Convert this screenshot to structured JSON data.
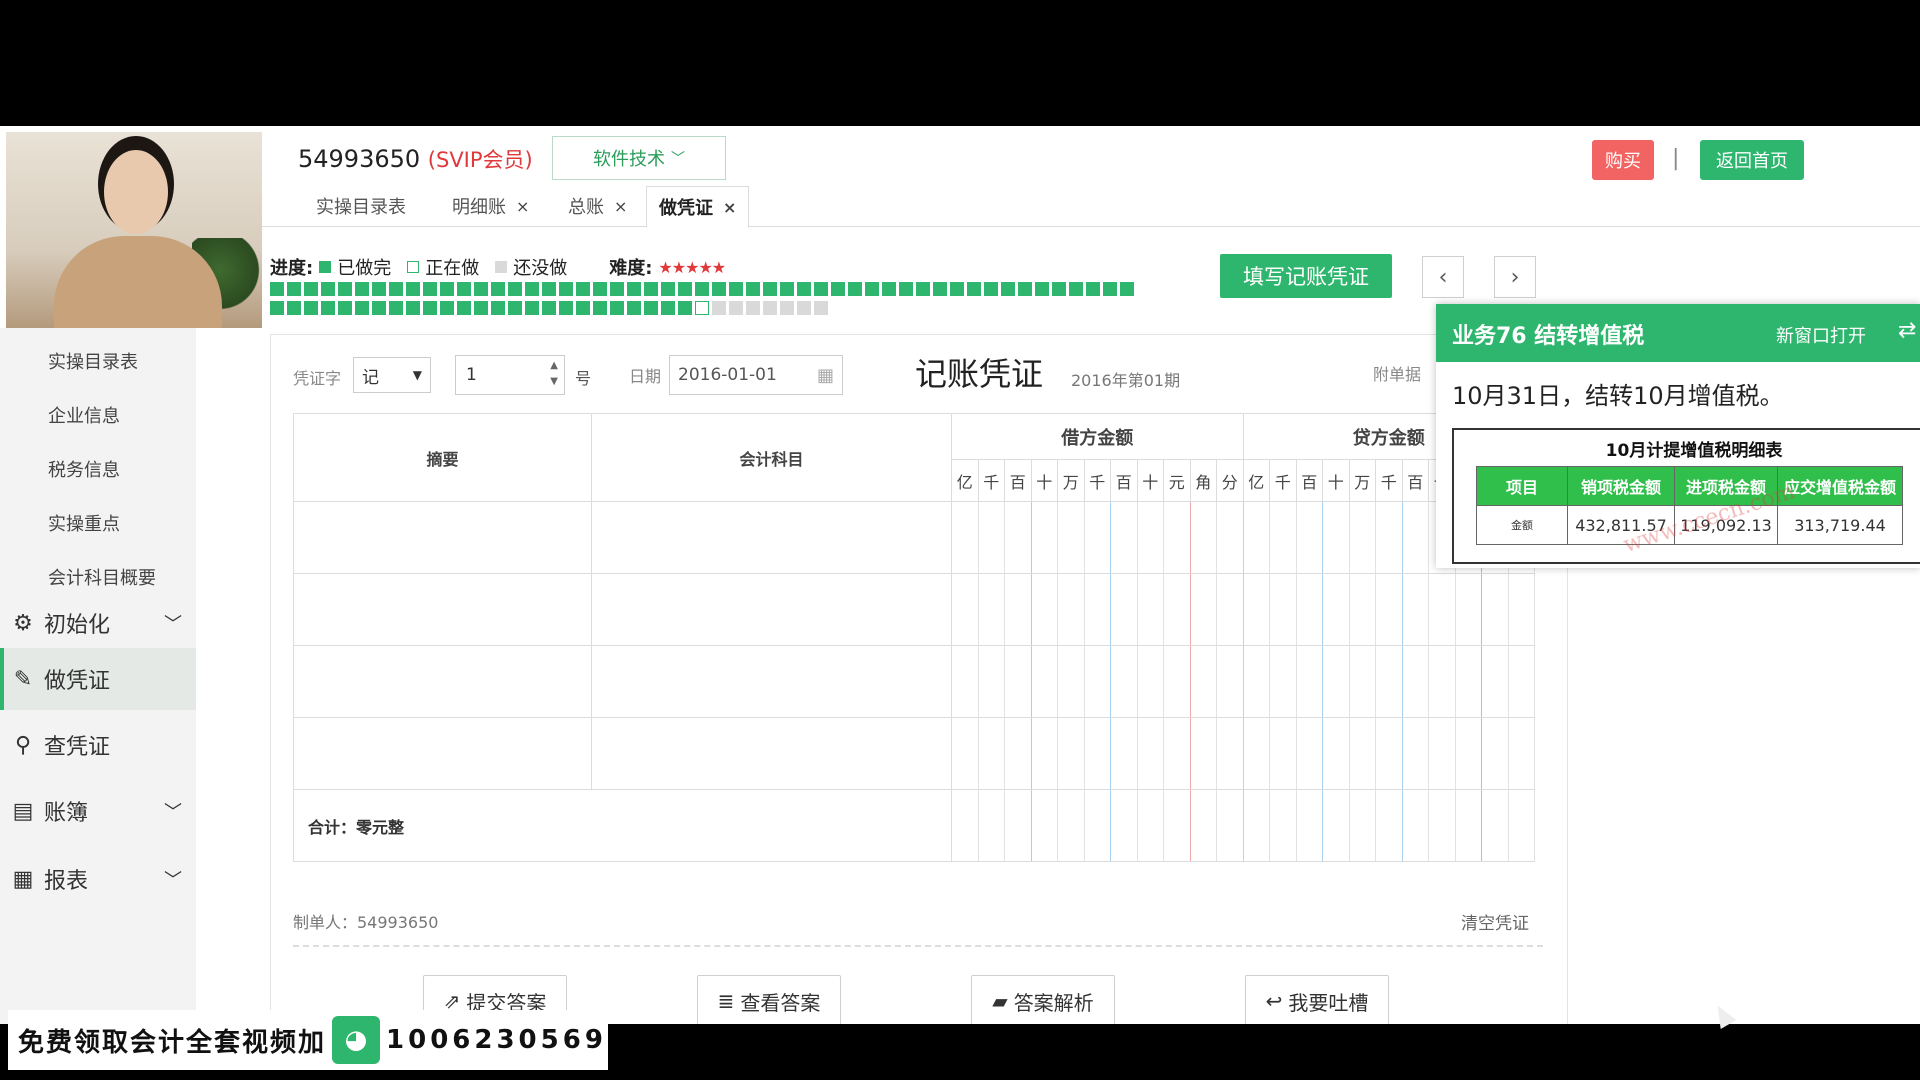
{
  "header": {
    "user_id": "54993650",
    "vip_label": "(SVIP会员)",
    "dropdown_label": "软件技术",
    "buy_label": "购买",
    "separator": "|",
    "home_label": "返回首页"
  },
  "tabs": [
    {
      "label": "实操目录表",
      "closable": false
    },
    {
      "label": "明细账",
      "closable": true
    },
    {
      "label": "总账",
      "closable": true
    },
    {
      "label": "做凭证",
      "closable": true
    }
  ],
  "tab_close_glyph": "×",
  "sidebar": {
    "sub_items": [
      "实操目录表",
      "企业信息",
      "税务信息",
      "实操重点",
      "会计科目概要"
    ],
    "main_items": [
      {
        "label": "初始化",
        "icon": "gear-icon",
        "expandable": true
      },
      {
        "label": "做凭证",
        "icon": "pen-icon",
        "expandable": false
      },
      {
        "label": "查凭证",
        "icon": "search-icon",
        "expandable": false
      },
      {
        "label": "账簿",
        "icon": "book-icon",
        "expandable": true
      },
      {
        "label": "报表",
        "icon": "report-icon",
        "expandable": true
      }
    ]
  },
  "progress": {
    "label": "进度:",
    "done": "已做完",
    "doing": "正在做",
    "todo": "还没做",
    "difficulty_label": "难度:",
    "difficulty_stars": 5,
    "done_count": 76,
    "current_index": 77,
    "total_count": 84,
    "colors": {
      "done": "#2eb66e",
      "doing": "#ffffff",
      "todo": "#d9d9d9"
    }
  },
  "fill_button": "填写记账凭证",
  "nav": {
    "prev": "‹",
    "next": "›"
  },
  "voucher": {
    "word_label": "凭证字",
    "word_value": "记",
    "number_value": "1",
    "number_suffix": "号",
    "date_label": "日期",
    "date_value": "2016-01-01",
    "title": "记账凭证",
    "period": "2016年第01期",
    "attach_label": "附单据",
    "col_summary": "摘要",
    "col_account": "会计科目",
    "col_debit": "借方金额",
    "col_credit": "贷方金额",
    "digits": [
      "亿",
      "千",
      "百",
      "十",
      "万",
      "千",
      "百",
      "十",
      "元",
      "角",
      "分"
    ],
    "total_label": "合计：零元整",
    "maker_label": "制单人：54993650",
    "clear_label": "清空凭证"
  },
  "actions": [
    {
      "label": "提交答案",
      "icon": "external-link-icon"
    },
    {
      "label": "查看答案",
      "icon": "database-icon"
    },
    {
      "label": "答案解析",
      "icon": "folder-open-icon"
    },
    {
      "label": "我要吐槽",
      "icon": "reply-icon"
    }
  ],
  "popup": {
    "title": "业务76 结转增值税",
    "open_new": "新窗口打开",
    "switch_glyph": "⇄",
    "description": "10月31日，结转10月增值税。",
    "table_title": "10月计提增值税明细表",
    "headers": [
      "项目",
      "销项税金额",
      "进项税金额",
      "应交增值税金额"
    ],
    "row": [
      "金额",
      "432,811.57",
      "119,092.13",
      "313,719.44"
    ],
    "watermark": "www.ccecn.com"
  },
  "banner": {
    "text": "免费领取会计全套视频加",
    "phone": "1006230569"
  }
}
